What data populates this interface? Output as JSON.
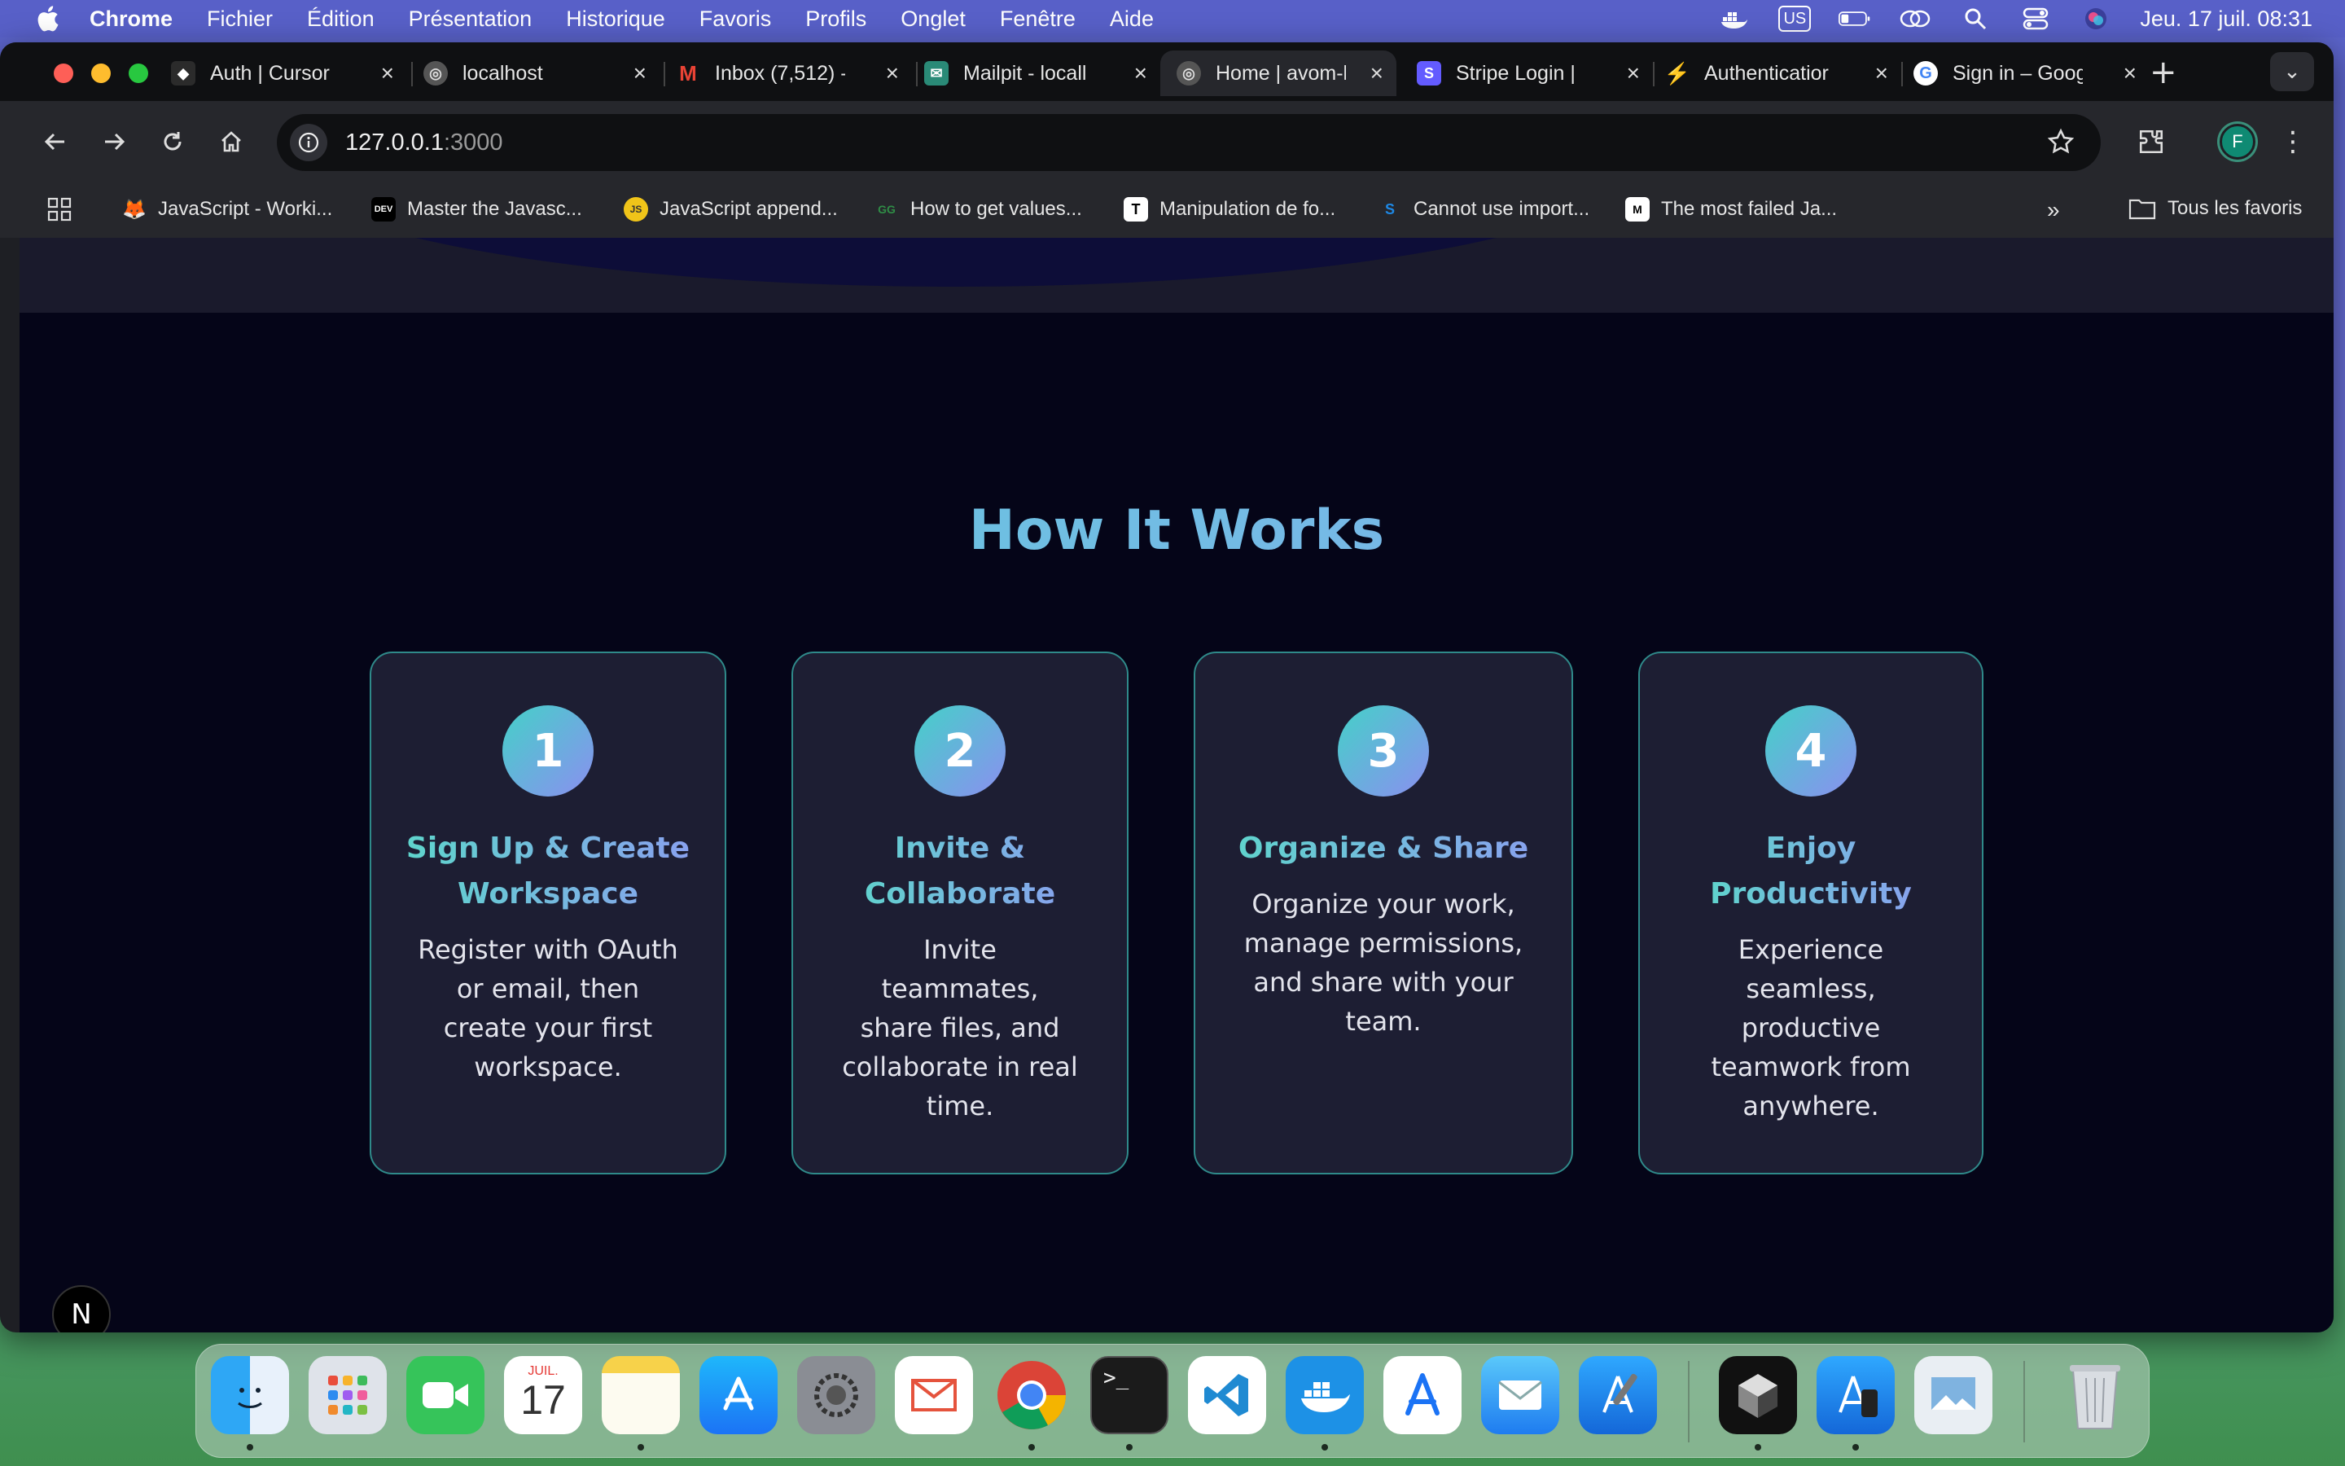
{
  "menubar": {
    "app_name": "Chrome",
    "items": [
      "Fichier",
      "Édition",
      "Présentation",
      "Historique",
      "Favoris",
      "Profils",
      "Onglet",
      "Fenêtre",
      "Aide"
    ],
    "keyboard_layout": "US",
    "clock": "Jeu. 17 juil.  08:31"
  },
  "tabs": [
    {
      "label": "Auth | Cursor",
      "icon": "cursor-icon",
      "active": false
    },
    {
      "label": "localhost",
      "icon": "globe-icon",
      "active": false
    },
    {
      "label": "Inbox (7,512) -",
      "icon": "gmail-icon",
      "active": false
    },
    {
      "label": "Mailpit - locall",
      "icon": "mailpit-icon",
      "active": false
    },
    {
      "label": "Home | avom-l",
      "icon": "globe-icon",
      "active": true
    },
    {
      "label": "Stripe Login |",
      "icon": "stripe-icon",
      "active": false
    },
    {
      "label": "Authenticatior",
      "icon": "supabase-icon",
      "active": false
    },
    {
      "label": "Sign in – Goog",
      "icon": "google-icon",
      "active": false
    }
  ],
  "address": {
    "host": "127.0.0.1",
    "port": ":3000"
  },
  "profile_initial": "F",
  "bookmarks": [
    {
      "label": "JavaScript - Worki...",
      "icon": "metamask-icon"
    },
    {
      "label": "Master the Javasc...",
      "icon": "dev-icon",
      "badge": "DEV"
    },
    {
      "label": "JavaScript append...",
      "icon": "js-icon",
      "badge": "JS"
    },
    {
      "label": "How to get values...",
      "icon": "geeks-icon",
      "badge": "GG"
    },
    {
      "label": "Manipulation de fo...",
      "icon": "text-icon",
      "badge": "T"
    },
    {
      "label": "Cannot use import...",
      "icon": "codepen-icon",
      "badge": "S"
    },
    {
      "label": "The most failed Ja...",
      "icon": "medium-icon",
      "badge": "M"
    }
  ],
  "bookmarks_all": "Tous les favoris",
  "page": {
    "section_title": "How It Works",
    "steps": [
      {
        "number": "1",
        "title": "Sign Up & Create Workspace",
        "desc": "Register with OAuth or email, then create your first workspace."
      },
      {
        "number": "2",
        "title": "Invite & Collaborate",
        "desc": "Invite teammates, share files, and collaborate in real time."
      },
      {
        "number": "3",
        "title": "Organize & Share",
        "desc": "Organize your work, manage permissions, and share with your team."
      },
      {
        "number": "4",
        "title": "Enjoy Productivity",
        "desc": "Experience seamless, productive teamwork from anywhere."
      }
    ],
    "dev_badge": "N"
  },
  "dock": {
    "calendar_month": "JUIL.",
    "calendar_day": "17",
    "apps": [
      "finder-icon",
      "launchpad-icon",
      "facetime-icon",
      "calendar-icon",
      "notes-icon",
      "app-store-icon",
      "system-settings-icon",
      "airmail-icon",
      "chrome-icon",
      "terminal-icon",
      "vscode-icon",
      "docker-icon",
      "instruments-icon",
      "mail-icon",
      "xcode-icon",
      "cursor-icon",
      "simulator-icon",
      "preview-icon",
      "trash-icon"
    ]
  }
}
